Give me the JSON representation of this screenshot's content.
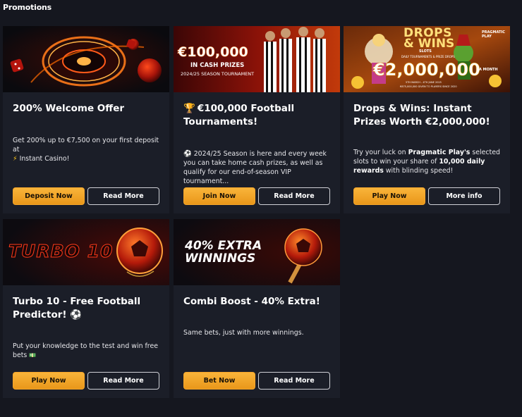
{
  "page": {
    "title": "Promotions"
  },
  "cards": [
    {
      "title": "200% Welcome Offer",
      "desc": "Get 200% up to €7,500 on your first deposit at",
      "desc2": "Instant Casino!",
      "desc_icon": "lightning-icon",
      "primary": "Deposit Now",
      "secondary": "Read More"
    },
    {
      "title_icon": "trophy-icon",
      "title": "€100,000 Football Tournaments!",
      "desc_icon": "soccer-ball-icon",
      "desc": "2024/25 Season is here and every week you can take home cash prizes, as well as qualify for our end-of-season VIP tournament...",
      "primary": "Join Now",
      "secondary": "Read More",
      "banner": {
        "big": "€100,000",
        "sub": "IN CASH PRIZES",
        "season": "2024/25 SEASON TOURNAMENT"
      }
    },
    {
      "title": "Drops & Wins: Instant Prizes Worth €2,000,000!",
      "desc_a": "Try your luck on",
      "desc_b": "Pragmatic Play's",
      "desc_c": "selected slots to win your share of",
      "desc_d": "10,000 daily rewards",
      "desc_e": "with blinding speed!",
      "primary": "Play Now",
      "secondary": "More info",
      "banner": {
        "line1": "DROPS",
        "line2": "& WINS",
        "slots": "SLOTS",
        "tag": "DAILY TOURNAMENTS & PRIZE DROPS",
        "amount": "€2,000,000",
        "month": "A MONTH",
        "dates": "5TH MARCH - 4TH JUNE 2025",
        "given": "€875,000,000 GIVEN TO PLAYERS SINCE 2020",
        "brand": "PRAGMATIC PLAY"
      }
    },
    {
      "title": "Turbo 10 - Free Football Predictor!",
      "title_icon": "soccer-ball-icon",
      "desc": "Put your knowledge to the test and win free bets",
      "desc_icon": "money-icon",
      "primary": "Play Now",
      "secondary": "Read More",
      "banner": {
        "text": "TURBO 10"
      }
    },
    {
      "title": "Combi Boost - 40% Extra!",
      "desc": "Same bets, just with more winnings.",
      "primary": "Bet Now",
      "secondary": "Read More",
      "banner": {
        "line1": "40% EXTRA",
        "line2": "WINNINGS"
      }
    }
  ],
  "colors": {
    "background": "#15171f",
    "card": "#1b1e28",
    "accent": "#f4a52a"
  }
}
